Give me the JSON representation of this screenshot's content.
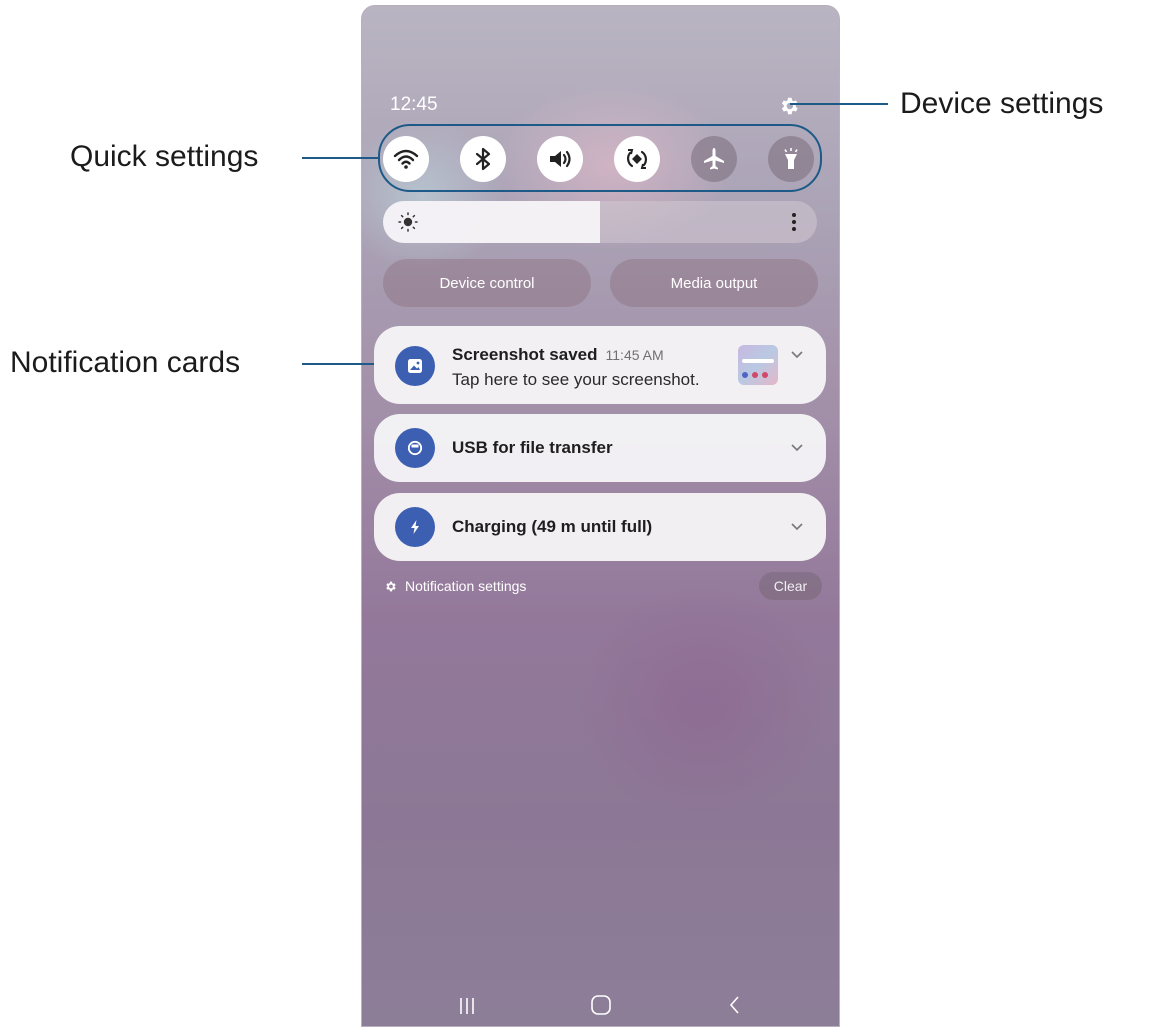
{
  "status_bar": {
    "time": "12:45"
  },
  "quick_settings": [
    {
      "name": "wifi",
      "icon": "wifi-icon",
      "state": "on"
    },
    {
      "name": "bluetooth",
      "icon": "bluetooth-icon",
      "state": "on"
    },
    {
      "name": "sound",
      "icon": "sound-icon",
      "state": "on"
    },
    {
      "name": "auto-rotate",
      "icon": "auto-rotate-icon",
      "state": "on"
    },
    {
      "name": "airplane-mode",
      "icon": "airplane-icon",
      "state": "off"
    },
    {
      "name": "flashlight",
      "icon": "flashlight-icon",
      "state": "off"
    }
  ],
  "brightness": {
    "level": 0.5,
    "icon": "sun-icon",
    "more_icon": "more-vertical-icon"
  },
  "buttons": {
    "device_control": "Device control",
    "media_output": "Media output"
  },
  "notifications": [
    {
      "icon": "image-icon",
      "title": "Screenshot saved",
      "time": "11:45 AM",
      "body": "Tap here to see your screenshot.",
      "has_thumbnail": true
    },
    {
      "icon": "usb-icon",
      "title": "USB for file transfer"
    },
    {
      "icon": "bolt-icon",
      "title": "Charging (49 m until full)"
    }
  ],
  "footer": {
    "notification_settings": "Notification settings",
    "clear": "Clear"
  },
  "navigation": [
    "recents-icon",
    "home-icon",
    "back-icon"
  ],
  "annotations": {
    "device_settings": "Device settings",
    "quick_settings": "Quick settings",
    "notification_cards": "Notification cards"
  },
  "colors": {
    "callout": "#1d5a87",
    "notification_icon": "#3d5fb2"
  }
}
